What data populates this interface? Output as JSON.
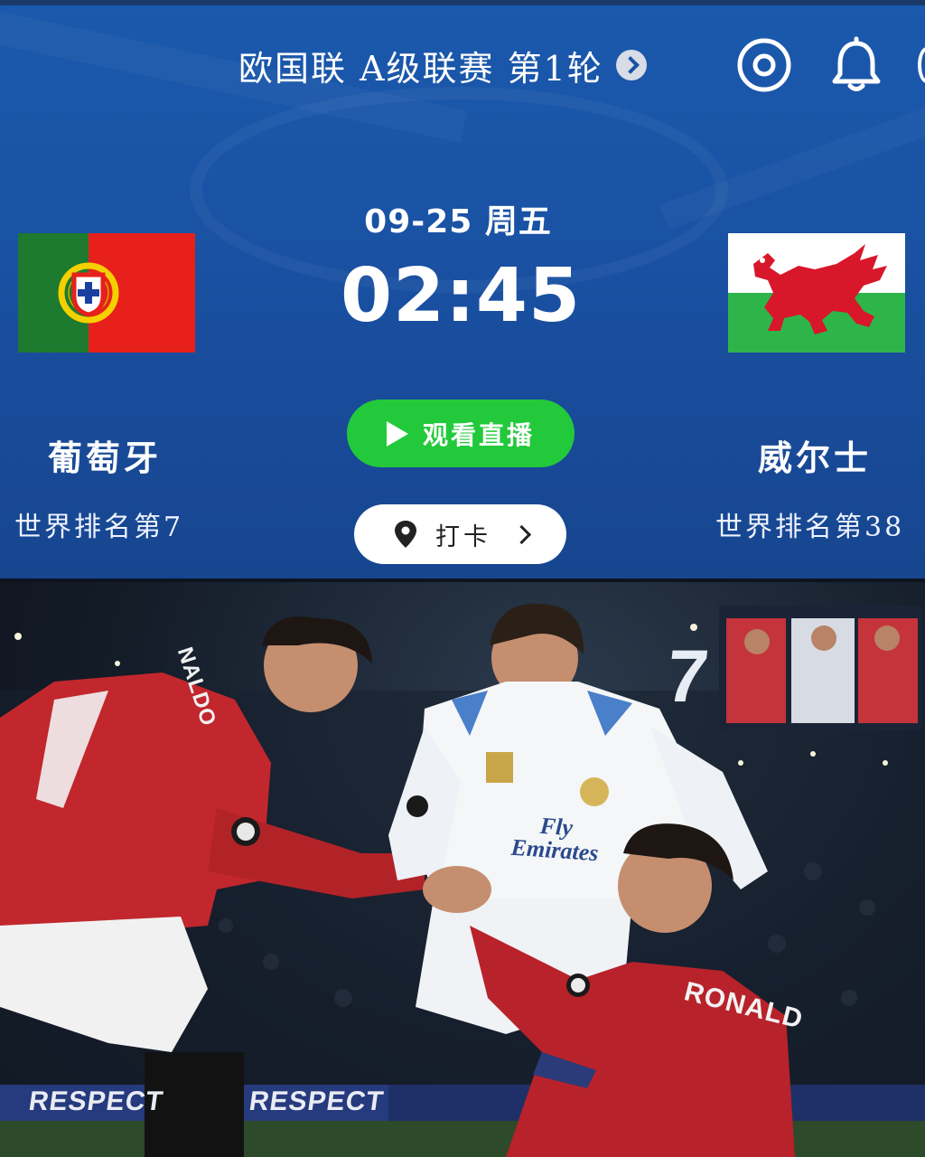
{
  "header": {
    "competition": "欧国联 A级联赛 第1轮",
    "icons": [
      "target-icon",
      "bell-icon"
    ]
  },
  "match": {
    "date": "09-25 周五",
    "time": "02:45",
    "watch_label": "观看直播",
    "checkin_label": "打卡"
  },
  "home_team": {
    "name": "葡萄牙",
    "rank": "世界排名第7",
    "flag": "portugal-flag"
  },
  "away_team": {
    "name": "威尔士",
    "rank": "世界排名第38",
    "flag": "wales-flag"
  },
  "photo": {
    "screen_number": "7",
    "banner_left": "RESPECT",
    "banner_right": "RESPECT",
    "shirt_name_left": "NALDO",
    "shirt_name_right": "RONALD",
    "sponsor_line1": "Fly",
    "sponsor_line2": "Emirates"
  },
  "colors": {
    "panel_blue": "#1a52a4",
    "watch_green": "#22c93a",
    "portugal_green": "#1e7a2e",
    "portugal_red": "#e8201c",
    "wales_red": "#d8172b",
    "wales_green": "#2eb54a"
  }
}
